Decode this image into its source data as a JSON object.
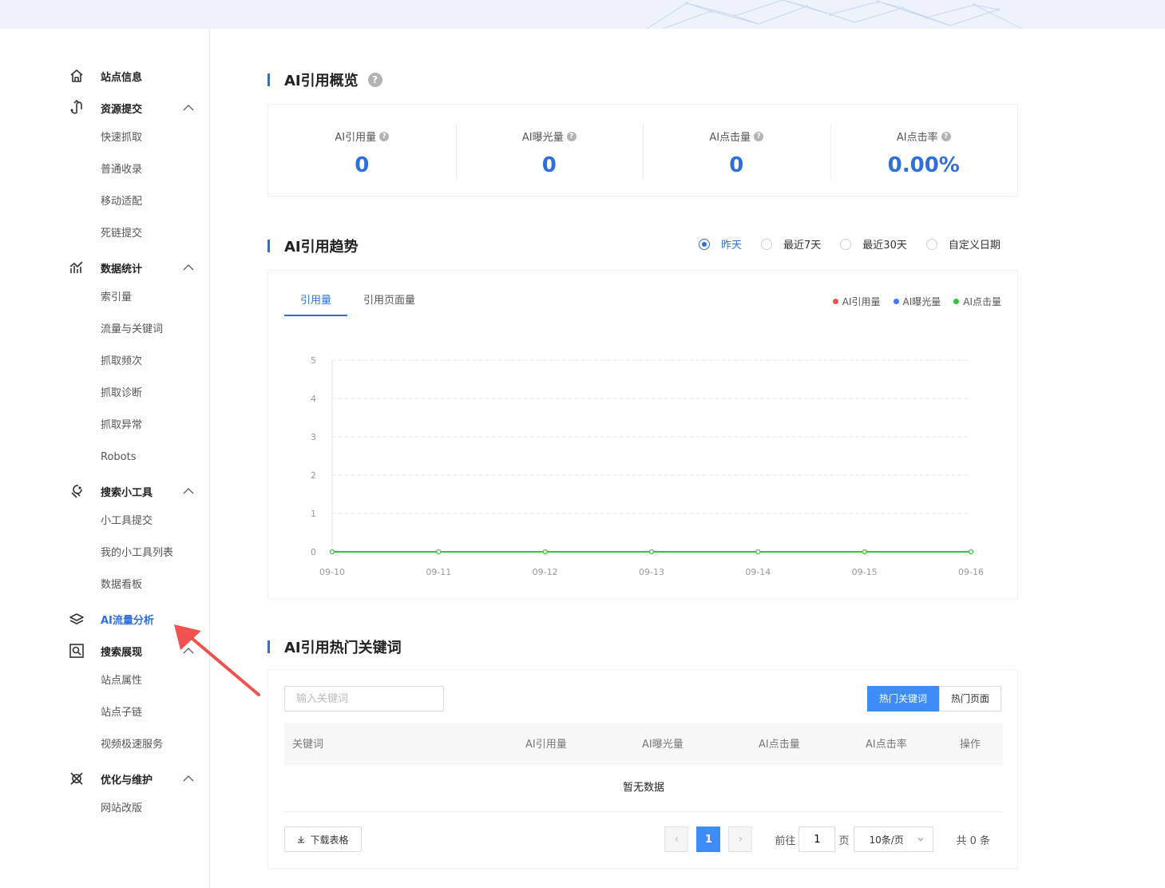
{
  "sidebar": {
    "groups": [
      {
        "label": "站点信息",
        "icon": "home-icon"
      },
      {
        "label": "资源提交",
        "icon": "submit-icon",
        "items": [
          "快速抓取",
          "普通收录",
          "移动适配",
          "死链提交"
        ]
      },
      {
        "label": "数据统计",
        "icon": "chart-icon",
        "items": [
          "索引量",
          "流量与关键词",
          "抓取频次",
          "抓取诊断",
          "抓取异常",
          "Robots"
        ]
      },
      {
        "label": "搜索小工具",
        "icon": "tools-icon",
        "items": [
          "小工具提交",
          "我的小工具列表",
          "数据看板"
        ]
      },
      {
        "label": "AI流量分析",
        "icon": "ai-icon"
      },
      {
        "label": "搜索展现",
        "icon": "search-display-icon",
        "items": [
          "站点属性",
          "站点子链",
          "视频极速服务"
        ]
      },
      {
        "label": "优化与维护",
        "icon": "optimize-icon",
        "items": [
          "网站改版"
        ]
      }
    ],
    "active_color": "#2f6fdc"
  },
  "overview": {
    "title": "AI引用概览",
    "metrics": [
      {
        "label": "AI引用量",
        "value": "0"
      },
      {
        "label": "AI曝光量",
        "value": "0"
      },
      {
        "label": "AI点击量",
        "value": "0"
      },
      {
        "label": "AI点击率",
        "value": "0.00%"
      }
    ]
  },
  "trend": {
    "title": "AI引用趋势",
    "ranges": [
      "昨天",
      "最近7天",
      "最近30天",
      "自定义日期"
    ],
    "selected_range": "昨天",
    "tabs": [
      "引用量",
      "引用页面量"
    ],
    "active_tab": "引用量",
    "legend": [
      {
        "name": "AI引用量",
        "color": "#f0524f"
      },
      {
        "name": "AI曝光量",
        "color": "#3d7cf5"
      },
      {
        "name": "AI点击量",
        "color": "#2ec734"
      }
    ]
  },
  "chart_data": {
    "type": "line",
    "x": [
      "09-10",
      "09-11",
      "09-12",
      "09-13",
      "09-14",
      "09-15",
      "09-16"
    ],
    "series": [
      {
        "name": "AI点击量",
        "values": [
          0,
          0,
          0,
          0,
          0,
          0,
          0
        ],
        "color": "#2ec734"
      }
    ],
    "yticks": [
      "0",
      "1",
      "2",
      "3",
      "4",
      "5"
    ],
    "ylim": [
      0,
      5
    ],
    "grid": true,
    "legend_position": "top-right"
  },
  "keywords": {
    "title": "AI引用热门关键词",
    "search_placeholder": "输入关键词",
    "toggle": [
      "热门关键词",
      "热门页面"
    ],
    "active_toggle": "热门关键词",
    "columns": [
      "关键词",
      "AI引用量",
      "AI曝光量",
      "AI点击量",
      "AI点击率",
      "操作"
    ],
    "empty_text": "暂无数据",
    "download_label": "下载表格",
    "pager": {
      "current": "1",
      "goto_prefix": "前往",
      "goto_value": "1",
      "goto_suffix": "页",
      "page_size": "10条/页",
      "total": "共 0 条"
    }
  },
  "annotation": {
    "arrow_color": "#f0524f"
  }
}
